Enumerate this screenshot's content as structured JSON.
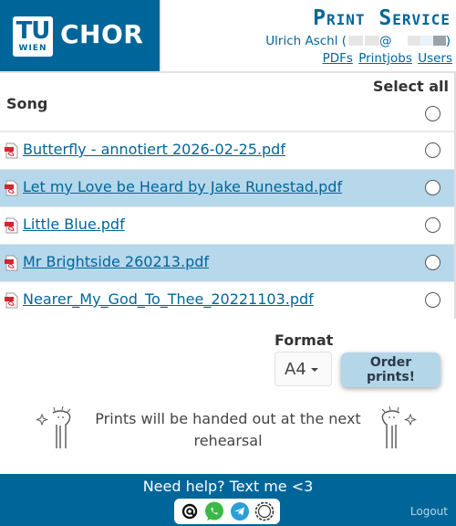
{
  "header": {
    "logo_tu": "TU",
    "logo_wien": "WIEN",
    "logo_chor": "CHOR",
    "title": "Print Service",
    "user_name": "Ulrich Aschl (",
    "user_at": "@",
    "user_close": ")",
    "nav": [
      "PDFs",
      "Printjobs",
      "Users"
    ]
  },
  "table": {
    "col_song": "Song",
    "col_select_all": "Select all",
    "rows": [
      "Butterfly - annotiert 2026-02-25.pdf",
      "Let my Love be Heard by Jake Runestad.pdf",
      "Little Blue.pdf",
      "Mr Brightside 260213.pdf",
      "Nearer_My_God_To_Thee_20221103.pdf"
    ]
  },
  "order": {
    "format_label": "Format",
    "format_value": "A4",
    "order_button": "Order prints!",
    "notice": "Prints will be handed out at the next rehearsal"
  },
  "footer": {
    "help": "Need help? Text me <3",
    "logout": "Logout",
    "contact_icons": [
      "email-icon",
      "whatsapp-icon",
      "telegram-icon",
      "signal-icon"
    ]
  },
  "colors": {
    "brand": "#006699",
    "row_highlight": "#b7d7ea",
    "button": "#b4d6e9"
  }
}
